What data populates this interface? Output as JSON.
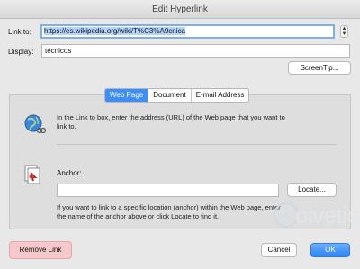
{
  "window": {
    "title": "Edit Hyperlink"
  },
  "link_to": {
    "label": "Link to:",
    "value": "https://es.wikipedia.org/wiki/T%C3%A9cnica"
  },
  "display": {
    "label": "Display:",
    "value": "técnicos"
  },
  "screentip_button": "ScreenTip...",
  "tabs": [
    {
      "label": "Web Page",
      "active": true
    },
    {
      "label": "Document",
      "active": false
    },
    {
      "label": "E-mail Address",
      "active": false
    }
  ],
  "web_page": {
    "description": "In the Link to box, enter the address (URL) of the Web page that you want to link to."
  },
  "anchor": {
    "label": "Anchor:",
    "value": "",
    "locate_button": "Locate...",
    "description": "If you want to link to a specific location (anchor) within the Web page, enter the name of the anchor above or click Locate to find it."
  },
  "buttons": {
    "remove_link": "Remove Link",
    "cancel": "Cancel",
    "ok": "OK"
  },
  "watermark": "olvetic",
  "colors": {
    "accent": "#3e8ef7",
    "remove_highlight": "#f5c9cc"
  }
}
